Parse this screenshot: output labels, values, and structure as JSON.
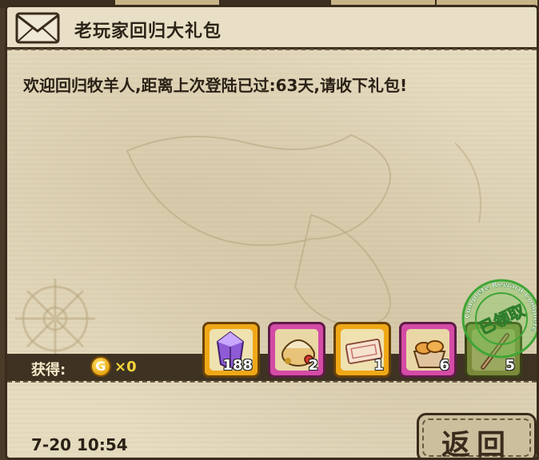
{
  "mail": {
    "title": "老玩家回归大礼包",
    "message": "欢迎回归牧羊人,距离上次登陆已过:63天,请收下礼包!",
    "date": "7-20 10:54"
  },
  "rewards": {
    "gain_label": "获得:",
    "coin_glyph": "G",
    "coin_count": "×0",
    "items": [
      {
        "icon": "purple-gem-icon",
        "count": "188",
        "frame": "gold"
      },
      {
        "icon": "food-basket-icon",
        "count": "2",
        "frame": "pink"
      },
      {
        "icon": "ticket-icon",
        "count": "1",
        "frame": "gold"
      },
      {
        "icon": "bread-basket-icon",
        "count": "6",
        "frame": "pink"
      },
      {
        "icon": "tool-icon",
        "count": "5",
        "frame": "green"
      }
    ]
  },
  "stamp": {
    "text": "已领取",
    "ring_text": "Complete Reward Complete"
  },
  "buttons": {
    "return_label": "返回"
  },
  "colors": {
    "parchment": "#e6dcc0",
    "frame_dark": "#3a2c1c",
    "coin_gold": "#f5d53a",
    "stamp_green": "#4caf3a"
  }
}
